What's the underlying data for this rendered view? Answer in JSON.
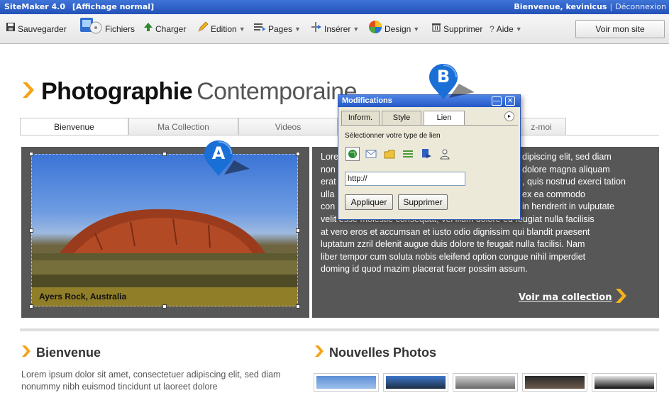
{
  "titlebar": {
    "app": "SiteMaker 4.0",
    "mode": "[Affichage normal]",
    "welcome": "Bienvenue, kevinicus",
    "separator": "|",
    "logout": "Déconnexion"
  },
  "toolbar": {
    "items": [
      {
        "label": "Sauvegarder",
        "icon": "save-icon",
        "dropdown": false
      },
      {
        "label": "Fichiers",
        "icon": "files-icon",
        "dropdown": false
      },
      {
        "label": "Charger",
        "icon": "upload-arrow-icon",
        "dropdown": false
      },
      {
        "label": "Edition",
        "icon": "pencil-icon",
        "dropdown": true
      },
      {
        "label": "Pages",
        "icon": "pages-icon",
        "dropdown": true
      },
      {
        "label": "Insérer",
        "icon": "insert-icon",
        "dropdown": true
      },
      {
        "label": "Design",
        "icon": "palette-icon",
        "dropdown": true
      },
      {
        "label": "Supprimer",
        "icon": "trash-icon",
        "dropdown": false
      },
      {
        "label": "Aide",
        "icon": "help-icon",
        "glyph": "?",
        "dropdown": true
      }
    ],
    "caret": "▼",
    "view_site": "Voir mon site"
  },
  "site": {
    "title_bold": "Photographie",
    "title_light": "Contemporaine",
    "tabs": [
      {
        "label": "Bienvenue",
        "active": true
      },
      {
        "label": "Ma Collection",
        "active": false
      },
      {
        "label": "Videos",
        "active": false
      },
      {
        "label": "z-moi",
        "active": false
      }
    ],
    "photo_caption": "Ayers Rock, Australia",
    "lorem_lines": [
      "Lore",
      "non",
      "erat",
      "ulla",
      "con",
      "velit esse molestie consequat, vel illum dolore eu feugiat nulla facilisis",
      "at vero eros et accumsan et iusto odio dignissim qui blandit praesent",
      "luptatum zzril delenit augue duis dolore te feugait nulla facilisi. Nam",
      "liber tempor cum soluta nobis eleifend option congue nihil imperdiet",
      "doming id quod mazim placerat facer possim assum."
    ],
    "lorem_right_fragments": [
      "dipiscing elit, sed diam",
      "dolore magna aliquam",
      ", quis nostrud exerci tation",
      "ex ea commodo",
      "in hendrerit in vulputate"
    ],
    "see_collection": "Voir ma collection",
    "section_left": "Bienvenue",
    "section_right": "Nouvelles Photos",
    "bienvenue_text": "Lorem ipsum dolor sit amet, consectetuer adipiscing elit, sed diam nonummy nibh euismod tincidunt ut laoreet dolore"
  },
  "markers": {
    "a": "A",
    "b": "B",
    "color": "#1a6fd6"
  },
  "dialog": {
    "title": "Modifications",
    "minimize": "—",
    "close": "✕",
    "tabs": [
      {
        "label": "Inform.",
        "active": false
      },
      {
        "label": "Style",
        "active": false
      },
      {
        "label": "Lien",
        "active": true
      }
    ],
    "prompt": "Sélectionner votre type de lien",
    "link_types": [
      "globe-icon",
      "email-icon",
      "folder-icon",
      "list-icon",
      "page-link-icon",
      "person-icon"
    ],
    "url_value": "http://",
    "apply": "Appliquer",
    "remove": "Supprimer"
  },
  "colors": {
    "accent_orange": "#f5a31a",
    "titlebar_blue": "#2f63c9",
    "panel_gray": "#575757"
  }
}
